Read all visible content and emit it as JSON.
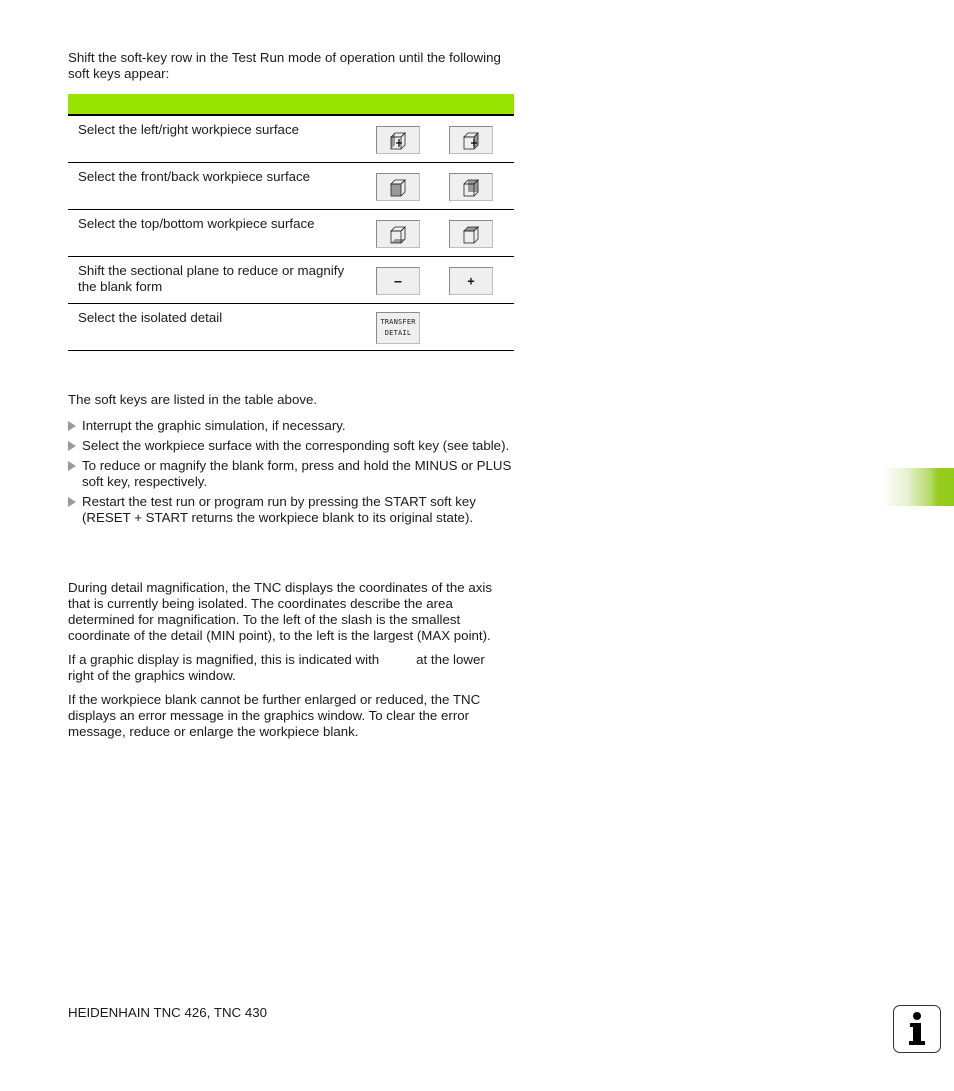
{
  "intro": "Shift the soft-key row in the Test Run mode of operation until the following soft keys appear:",
  "table": {
    "header_color": "#98e400",
    "rows": [
      {
        "description": "Select the left/right workpiece surface",
        "keys": [
          {
            "icon": "cube-left-face-icon"
          },
          {
            "icon": "cube-right-face-icon"
          }
        ]
      },
      {
        "description": "Select the front/back workpiece surface",
        "keys": [
          {
            "icon": "cube-front-face-icon"
          },
          {
            "icon": "cube-back-face-icon"
          }
        ]
      },
      {
        "description": "Select the top/bottom workpiece surface",
        "keys": [
          {
            "icon": "cube-bottom-face-icon"
          },
          {
            "icon": "cube-top-face-icon"
          }
        ]
      },
      {
        "description": "Shift the sectional plane to reduce or magnify the blank form",
        "keys": [
          {
            "label": "–"
          },
          {
            "label": "+"
          }
        ]
      },
      {
        "description": "Select the isolated detail",
        "keys": [
          {
            "label_line1": "TRANSFER",
            "label_line2": "DETAIL"
          }
        ]
      }
    ]
  },
  "after_table": "The soft keys are listed in the table above.",
  "steps": [
    "Interrupt the graphic simulation, if necessary.",
    "Select the workpiece surface with the corresponding soft key (see table).",
    "To reduce or magnify the blank form, press and hold the MINUS or PLUS soft key, respectively.",
    "Restart the test run or program run by pressing the START soft key (RESET + START returns the workpiece blank to its original state)."
  ],
  "notes": [
    "During detail magnification, the TNC displays the coordinates of the axis that is currently being isolated. The coordinates describe the area determined for magnification. To the left of the slash is the smallest coordinate of the detail (MIN point), to the left is the largest (MAX point).",
    "If a graphic display is magnified, this is indicated with          at the lower right of the graphics window.",
    "If the workpiece blank cannot be further enlarged or reduced, the TNC displays an error message in the graphics window. To clear the error message, reduce or enlarge the workpiece blank."
  ],
  "footer": "HEIDENHAIN TNC 426, TNC 430",
  "info_icon": "i",
  "accent_color": "#98cc20"
}
